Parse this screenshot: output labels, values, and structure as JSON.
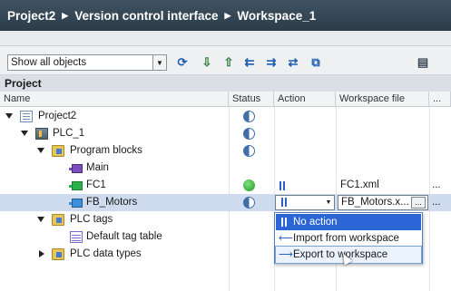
{
  "breadcrumb": [
    "Project2",
    "Version control interface",
    "Workspace_1"
  ],
  "toolbar": {
    "filter_value": "Show all objects",
    "icons": [
      "refresh-icon",
      "import-icon",
      "export-icon",
      "sync-left-icon",
      "sync-right-icon",
      "compare-icon",
      "settings-icon",
      "window-icon"
    ]
  },
  "panel": {
    "title": "Project"
  },
  "columns": {
    "name": "Name",
    "status": "Status",
    "action": "Action",
    "workspace_file": "Workspace file",
    "more": "..."
  },
  "rows": [
    {
      "label": "Project2",
      "status": "half"
    },
    {
      "label": "PLC_1",
      "status": "half"
    },
    {
      "label": "Program blocks",
      "status": "half"
    },
    {
      "label": "Main",
      "status": ""
    },
    {
      "label": "FC1",
      "status": "green",
      "action": "pause",
      "file": "FC1.xml",
      "more": "..."
    },
    {
      "label": "FB_Motors",
      "status": "half",
      "file": "FB_Motors.x...",
      "browse": "...",
      "more": "..."
    },
    {
      "label": "PLC tags"
    },
    {
      "label": "Default tag table"
    },
    {
      "label": "PLC data types"
    }
  ],
  "action_dropdown": {
    "options": [
      "No action",
      "Import from workspace",
      "Export to workspace"
    ],
    "selected": "No action",
    "hovered": "Export to workspace"
  }
}
